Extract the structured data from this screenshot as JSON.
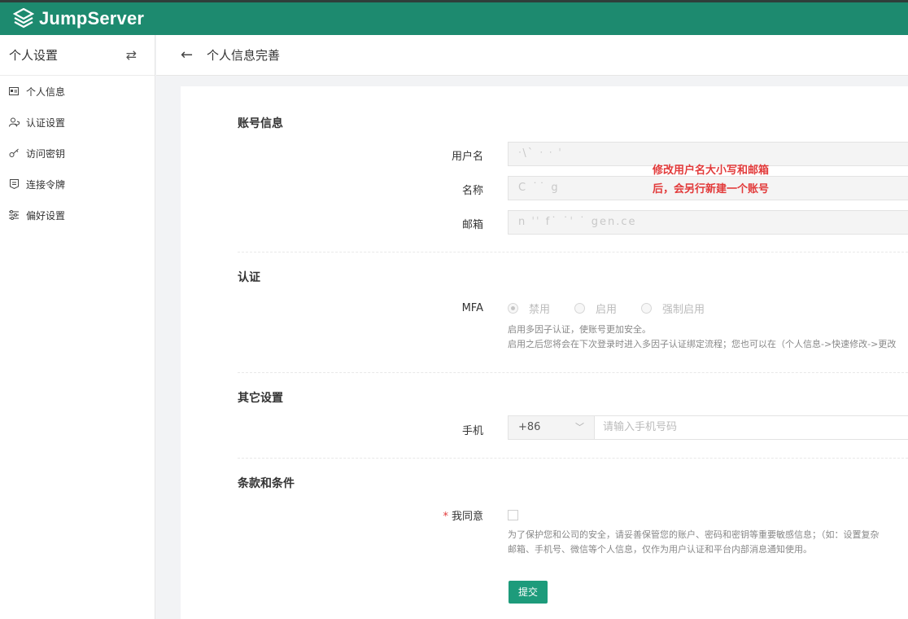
{
  "app": {
    "name": "JumpServer",
    "brand_color": "#1d8a6f"
  },
  "sidebar": {
    "title": "个人设置",
    "items": [
      {
        "label": "个人信息",
        "icon": "id-card-icon"
      },
      {
        "label": "认证设置",
        "icon": "user-shield-icon"
      },
      {
        "label": "访问密钥",
        "icon": "key-icon"
      },
      {
        "label": "连接令牌",
        "icon": "token-icon"
      },
      {
        "label": "偏好设置",
        "icon": "sliders-icon"
      }
    ]
  },
  "header": {
    "title": "个人信息完善"
  },
  "sections": {
    "account": {
      "title": "账号信息",
      "fields": {
        "username": {
          "label": "用户名",
          "value": "ᐧ\\ˋ ᐧ ᐧ ˈ"
        },
        "name": {
          "label": "名称",
          "value": "C ˙˙ g"
        },
        "email": {
          "label": "邮箱",
          "value": "n ˈˈ f˙ ˙ˈ ˙ gen.ce"
        }
      }
    },
    "auth": {
      "title": "认证",
      "mfa": {
        "label": "MFA",
        "options": [
          "禁用",
          "启用",
          "强制启用"
        ],
        "selected": "禁用",
        "help_line1": "启用多因子认证，使账号更加安全。",
        "help_line2": "启用之后您将会在下次登录时进入多因子认证绑定流程；您也可以在（个人信息->快速修改->更改"
      }
    },
    "other": {
      "title": "其它设置",
      "phone": {
        "label": "手机",
        "country_code": "+86",
        "placeholder": "请输入手机号码"
      }
    },
    "terms": {
      "title": "条款和条件",
      "agree": {
        "label": "我同意",
        "required_mark": "*",
        "checked": false,
        "help_line1": "为了保护您和公司的安全，请妥善保管您的账户、密码和密钥等重要敏感信息；（如：设置复杂",
        "help_line2": "邮箱、手机号、微信等个人信息，仅作为用户认证和平台内部消息通知使用。"
      },
      "submit_label": "提交"
    }
  },
  "annotation": {
    "line1": "修改用户名大小写和邮箱",
    "line2": "后，会另行新建一个账号",
    "color": "#e23a3a"
  }
}
